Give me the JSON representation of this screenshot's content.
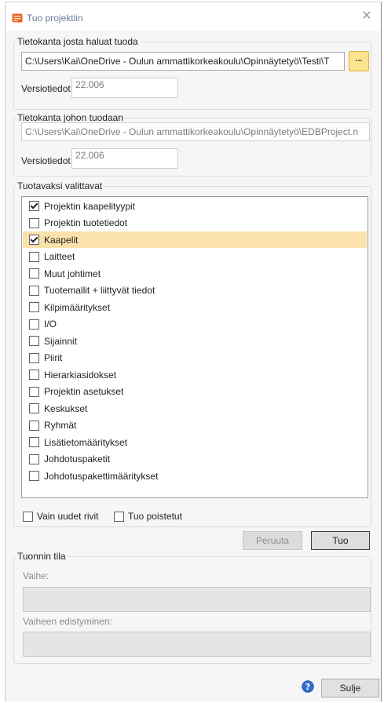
{
  "window": {
    "title": "Tuo projektiin",
    "close_glyph": "✕",
    "app_icon": "product-box-icon"
  },
  "source": {
    "group_title": "Tietokanta josta haluat tuoda",
    "path": "C:\\Users\\Kai\\OneDrive - Oulun ammattikorkeakoulu\\Opinnäytetyö\\Testi\\T",
    "browse_label": "...",
    "version_label": "Versiotiedot:",
    "version_value": "22.006"
  },
  "target": {
    "group_title": "Tietokanta johon tuodaan",
    "path": "C:\\Users\\Kai\\OneDrive - Oulun ammattikorkeakoulu\\Opinnäytetyö\\EDBProject.n",
    "version_label": "Versiotiedot:",
    "version_value": "22.006"
  },
  "selection": {
    "group_title": "Tuotavaksi valittavat",
    "items": [
      {
        "label": "Projektin kaapelityypit",
        "checked": true,
        "selected": false
      },
      {
        "label": "Projektin tuotetiedot",
        "checked": false,
        "selected": false
      },
      {
        "label": "Kaapelit",
        "checked": true,
        "selected": true
      },
      {
        "label": "Laitteet",
        "checked": false,
        "selected": false
      },
      {
        "label": "Muut johtimet",
        "checked": false,
        "selected": false
      },
      {
        "label": "Tuotemallit + liittyvät tiedot",
        "checked": false,
        "selected": false
      },
      {
        "label": "Kilpimääritykset",
        "checked": false,
        "selected": false
      },
      {
        "label": "I/O",
        "checked": false,
        "selected": false
      },
      {
        "label": "Sijainnit",
        "checked": false,
        "selected": false
      },
      {
        "label": "Piirit",
        "checked": false,
        "selected": false
      },
      {
        "label": "Hierarkiasidokset",
        "checked": false,
        "selected": false
      },
      {
        "label": "Projektin asetukset",
        "checked": false,
        "selected": false
      },
      {
        "label": "Keskukset",
        "checked": false,
        "selected": false
      },
      {
        "label": "Ryhmät",
        "checked": false,
        "selected": false
      },
      {
        "label": "Lisätietomääritykset",
        "checked": false,
        "selected": false
      },
      {
        "label": "Johdotuspaketit",
        "checked": false,
        "selected": false
      },
      {
        "label": "Johdotuspakettimääritykset",
        "checked": false,
        "selected": false
      }
    ],
    "only_new_rows_label": "Vain uudet rivit",
    "only_new_rows_checked": false,
    "import_deleted_label": "Tuo poistetut",
    "import_deleted_checked": false
  },
  "actions": {
    "cancel_label": "Peruuta",
    "import_label": "Tuo"
  },
  "status": {
    "group_title": "Tuonnin tila",
    "phase_label": "Vaihe:",
    "phase_value": "",
    "progress_label": "Vaiheen edistyminen:",
    "progress_value": ""
  },
  "footer": {
    "help_icon": "help-icon",
    "close_label": "Sulje"
  },
  "colors": {
    "selected_row": "#fbe2ab",
    "browse_button": "#fbe390",
    "help_icon": "#2f6fcf"
  }
}
